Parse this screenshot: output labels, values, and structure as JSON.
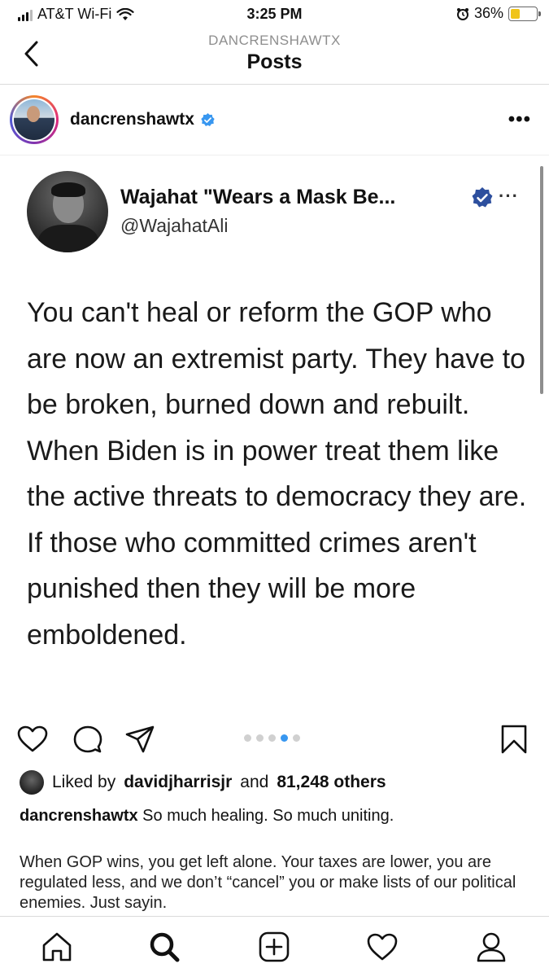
{
  "status_bar": {
    "carrier": "AT&T Wi-Fi",
    "time": "3:25 PM",
    "battery": "36%",
    "battery_level": 0.36,
    "icons": [
      "signal-icon",
      "wifi-icon",
      "alarm-icon",
      "battery-icon"
    ]
  },
  "header": {
    "subtitle": "DANCRENSHAWTX",
    "title": "Posts",
    "back_icon": "chevron-left-icon"
  },
  "post": {
    "username": "dancrenshawtx",
    "verified": true,
    "more_label": "•••",
    "tweet": {
      "name": "Wajahat \"Wears a Mask Be...",
      "handle": "@WajahatAli",
      "more_label": "···",
      "text": "You can't heal or reform the GOP who are now an extremist party. They have to be broken, burned down and rebuilt. When Biden is in power treat them like the active threats to democracy they are. If those who committed crimes aren't punished then they will be more emboldened."
    },
    "carousel": {
      "count": 5,
      "active_index": 3
    },
    "actions": [
      "heart-icon",
      "comment-icon",
      "share-icon",
      "bookmark-icon"
    ],
    "likes": {
      "prefix": "Liked by",
      "user": "davidjharrisjr",
      "joiner": "and",
      "others": "81,248 others"
    },
    "caption": {
      "username": "dancrenshawtx",
      "text": "So much healing. So much uniting.",
      "body": "When GOP wins, you get left alone. Your taxes are lower, you are regulated less, and we don’t “cancel” you or make lists of our political enemies. Just sayin."
    }
  },
  "tabbar": {
    "items": [
      "home-icon",
      "search-icon",
      "new-post-icon",
      "activity-icon",
      "profile-icon"
    ]
  },
  "colors": {
    "verified_blue": "#3897f0",
    "battery_yellow": "#f0c419",
    "divider": "#dbdbdb"
  }
}
